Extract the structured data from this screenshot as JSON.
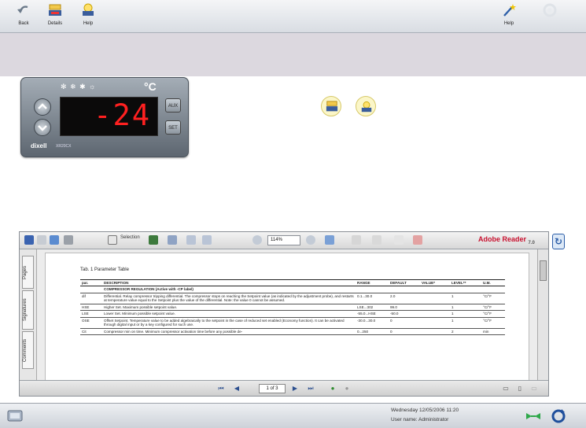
{
  "toolbar": {
    "left_buttons": [
      {
        "label": "Back",
        "icon": "back-arrow-icon"
      },
      {
        "label": "Details",
        "icon": "controller-icon"
      },
      {
        "label": "Help",
        "icon": "lightbulb-icon"
      }
    ],
    "right_button": {
      "label": "Help",
      "icon": "wand-icon"
    },
    "disabled_icon": "gear-icon"
  },
  "device": {
    "value": "-24",
    "unit": "°C",
    "icons_text": "✻ ❄ ✱ ☼",
    "brand": "dixell",
    "model": "XR20CX",
    "side_left_top": "aux",
    "side_right_top": "AUX",
    "side_right_bottom": "SET"
  },
  "pdf": {
    "toolbar": {
      "select_label": "Selection",
      "zoom": "114%",
      "adobe_label": "Adobe Reader",
      "adobe_version": "7.0"
    },
    "left_tabs": [
      "Pages",
      "Signatures",
      "Comments"
    ],
    "caption": "Tab. 1    Parameter Table",
    "columns": [
      "par.",
      "DESCRIPTION",
      "RANGE",
      "DEFAULT",
      "VALUE*",
      "LEVEL**",
      "U.M."
    ],
    "rows": [
      {
        "par": "",
        "desc": "COMPRESSOR REGULATION (Active with -CP label)",
        "range": "",
        "default": "",
        "value": "",
        "level": "",
        "um": ""
      },
      {
        "par": "dif",
        "desc": "Differential. Relay compressor tripping differential. The compressor stops on reaching the Setpoint value (as indicated by the adjustment probe), and restarts at temperature value equal to the Setpoint plus the value of the differential. Note: the value 0 cannot be assumed.",
        "range": "0.1...30.0",
        "default": "2.0",
        "value": "",
        "level": "1",
        "um": "°C/°F"
      },
      {
        "par": "HSE",
        "desc": "Higher Set. Maximum possible setpoint value.",
        "range": "LSE...302",
        "default": "99.0",
        "value": "",
        "level": "1",
        "um": "°C/°F"
      },
      {
        "par": "LSE",
        "desc": "Lower Set. Minimum possible setpoint value.",
        "range": "-55.0...HSE",
        "default": "-50.0",
        "value": "",
        "level": "1",
        "um": "°C/°F"
      },
      {
        "par": "OSE",
        "desc": "Offset Setpoint. Temperature value to be added algebraically to the setpoint in the case of reduced set enabled (Economy function). It can be activated through digital input or by a key configured for such use.",
        "range": "-30.0...30.0",
        "default": "0",
        "value": "",
        "level": "1",
        "um": "°C/°F"
      },
      {
        "par": "Cit",
        "desc": "Compressor min on time. Minimum compressor activation time before any possible de-",
        "range": "0...250",
        "default": "0",
        "value": "",
        "level": "2",
        "um": "min"
      }
    ],
    "nav": {
      "page": "1 of 3"
    }
  },
  "status": {
    "date_line": "Wednesday  12/05/2006    11:20",
    "user_line": "User name:  Administrator"
  },
  "colors": {
    "accent": "#2d5ea8",
    "display": "#ff2020",
    "band": "#dcd8df"
  }
}
